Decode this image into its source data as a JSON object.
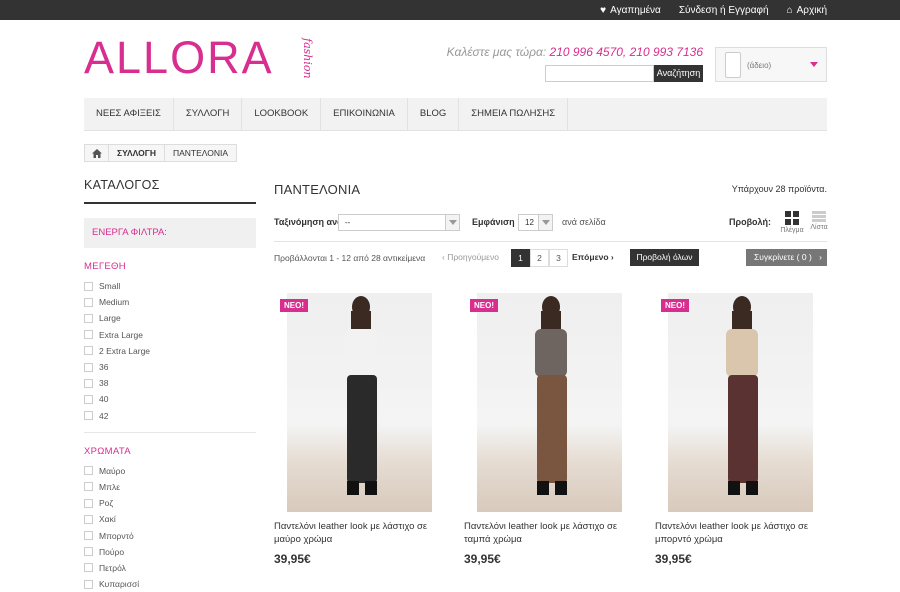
{
  "topbar": {
    "wishlist": "Αγαπημένα",
    "login": "Σύνδεση ή Εγγραφή",
    "home": "Αρχική"
  },
  "logo": {
    "main": "ALLORA",
    "sub": "fashion"
  },
  "header": {
    "phone_label": "Καλέστε μας τώρα:",
    "phone_numbers": "210 996 4570, 210 993 7136",
    "search_button": "Αναζήτηση",
    "search_placeholder": "",
    "cart_text": "(άδειο)"
  },
  "nav": [
    "ΝΕΕΣ ΑΦΙΞΕΙΣ",
    "ΣΥΛΛΟΓΗ",
    "LOOKBOOK",
    "ΕΠΙΚΟΙΝΩΝΙΑ",
    "BLOG",
    "ΣΗΜΕΙΑ ΠΩΛΗΣΗΣ"
  ],
  "breadcrumb": [
    "ΣΥΛΛΟΓΗ",
    "ΠΑΝΤΕΛΟΝΙΑ"
  ],
  "sidebar": {
    "title": "ΚΑΤΑΛΟΓΟΣ",
    "active_filters": "ΕΝΕΡΓΑ ΦΙΛΤΡΑ:",
    "sizes_title": "ΜΕΓΕΘΗ",
    "sizes": [
      "Small",
      "Medium",
      "Large",
      "Extra Large",
      "2 Extra Large",
      "36",
      "38",
      "40",
      "42"
    ],
    "colors_title": "ΧΡΩΜΑΤΑ",
    "colors": [
      "Μαύρο",
      "Μπλε",
      "Ροζ",
      "Χακί",
      "Μπορντό",
      "Πούρο",
      "Πετρόλ",
      "Κυπαρισσί"
    ]
  },
  "main": {
    "heading": "ΠΑΝΤΕΛΟΝΙΑ",
    "count": "Υπάρχουν 28 προϊόντα.",
    "sort_label": "Ταξινόμηση ανά",
    "sort_value": "--",
    "show_label": "Εμφάνιση",
    "show_value": "12",
    "per_page": "ανά σελίδα",
    "view_label": "Προβολή:",
    "view_grid": "Πλέγμα",
    "view_list": "Λίστα",
    "showing": "Προβάλλονται 1 - 12 από 28 αντικείμενα",
    "prev": "Προηγούμενο",
    "pages": [
      "1",
      "2",
      "3"
    ],
    "current_page": 1,
    "next": "Επόμενο",
    "show_all": "Προβολή όλων",
    "compare": "Συγκρίνετε ( 0 )"
  },
  "products": [
    {
      "badge": "ΝΕΟ!",
      "name": "Παντελόνι leather look με λάστιχο σε μαύρο χρώμα",
      "price": "39,95€",
      "top_color": "#f2f2f2",
      "pants_color": "#2a2a2a"
    },
    {
      "badge": "ΝΕΟ!",
      "name": "Παντελόνι leather look με λάστιχο σε ταμπά χρώμα",
      "price": "39,95€",
      "top_color": "#6e6460",
      "pants_color": "#7a5640"
    },
    {
      "badge": "ΝΕΟ!",
      "name": "Παντελόνι leather look με λάστιχο σε μπορντό χρώμα",
      "price": "39,95€",
      "top_color": "#d9c6ad",
      "pants_color": "#5a3232"
    }
  ],
  "colors": {
    "accent": "#d72e8f",
    "dark": "#333333"
  }
}
